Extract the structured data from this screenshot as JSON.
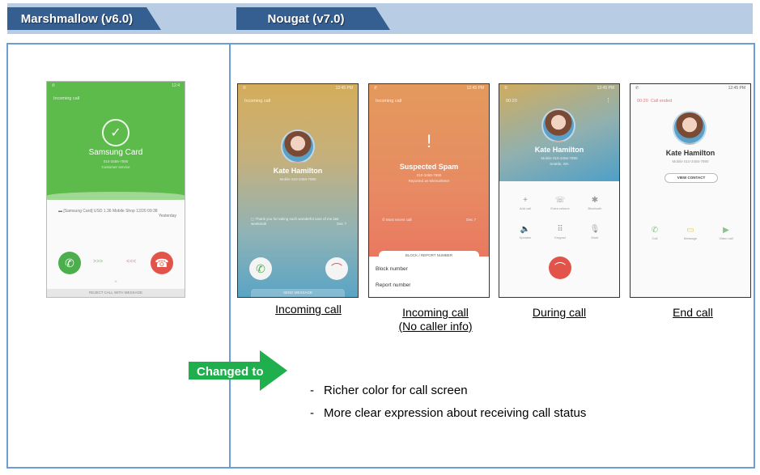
{
  "header": {
    "left_tab": "Marshmallow (v6.0)",
    "right_tab": "Nougat (v7.0)"
  },
  "marshmallow": {
    "status_time": "12:4",
    "label": "Incoming call",
    "caller": "Samsung Card",
    "number": "010-3456-7890",
    "subtitle": "Customer service",
    "message": "[Samsung Card] USD 1.36 Mobile Shop 12/20 09:38",
    "message_time": "Yesterday",
    "accept_hint": ">>>",
    "reject_hint": "<<<",
    "reject_with_message": "REJECT CALL WITH MESSAGE"
  },
  "nougat": {
    "screens": [
      {
        "caption": "Incoming call",
        "status_time": "12:45 PM",
        "label": "Incoming call",
        "name": "Kate Hamilton",
        "number": "Mobile 010-3456-7890",
        "message": "Thank you for taking such wonderful care of me last weekend!",
        "message_date": "Dec 7",
        "send_message": "SEND MESSAGE"
      },
      {
        "caption": "Incoming call",
        "caption2": "(No caller info)",
        "status_time": "12:45 PM",
        "label": "Incoming call",
        "name": "Suspected Spam",
        "number": "010-3456-7890",
        "subtitle": "Reported as telemarketer",
        "recent": "Most recent call",
        "recent_date": "Dec 7",
        "sheet_title": "BLOCK / REPORT NUMBER",
        "block": "Block number",
        "report": "Report number"
      },
      {
        "caption": "During call",
        "status_time": "12:45 PM",
        "timer": "00:20",
        "name": "Kate Hamilton",
        "number": "Mobile 010-3456-7890",
        "location": "Seattle, WA",
        "controls": [
          {
            "icon": "+",
            "label": "Add call"
          },
          {
            "icon": "☏",
            "label": "Extra volume"
          },
          {
            "icon": "✱",
            "label": "Bluetooth"
          },
          {
            "icon": "🔈",
            "label": "Speaker"
          },
          {
            "icon": "⠿",
            "label": "Keypad"
          },
          {
            "icon": "🎙",
            "label": "Mute"
          }
        ]
      },
      {
        "caption": "End call",
        "status_time": "12:45 PM",
        "timer": "00:20",
        "ended": "Call ended",
        "name": "Kate Hamilton",
        "number": "Mobile 010-3456-7890",
        "view_contact": "VIEW CONTACT",
        "actions": [
          {
            "icon": "✆",
            "label": "Call",
            "color": "#8bc48a"
          },
          {
            "icon": "▭",
            "label": "Message",
            "color": "#e2c85a"
          },
          {
            "icon": "▶",
            "label": "Video call",
            "color": "#8bc48a"
          }
        ]
      }
    ]
  },
  "changed_to": "Changed to",
  "bullets": [
    "Richer color for call screen",
    "More clear expression about receiving call status"
  ],
  "colors": {
    "tab": "#365f91",
    "band": "#b8cce4",
    "border": "#6a9fd6",
    "arrow": "#1faf4d",
    "accept": "#4cae4c",
    "reject": "#e2534a"
  }
}
